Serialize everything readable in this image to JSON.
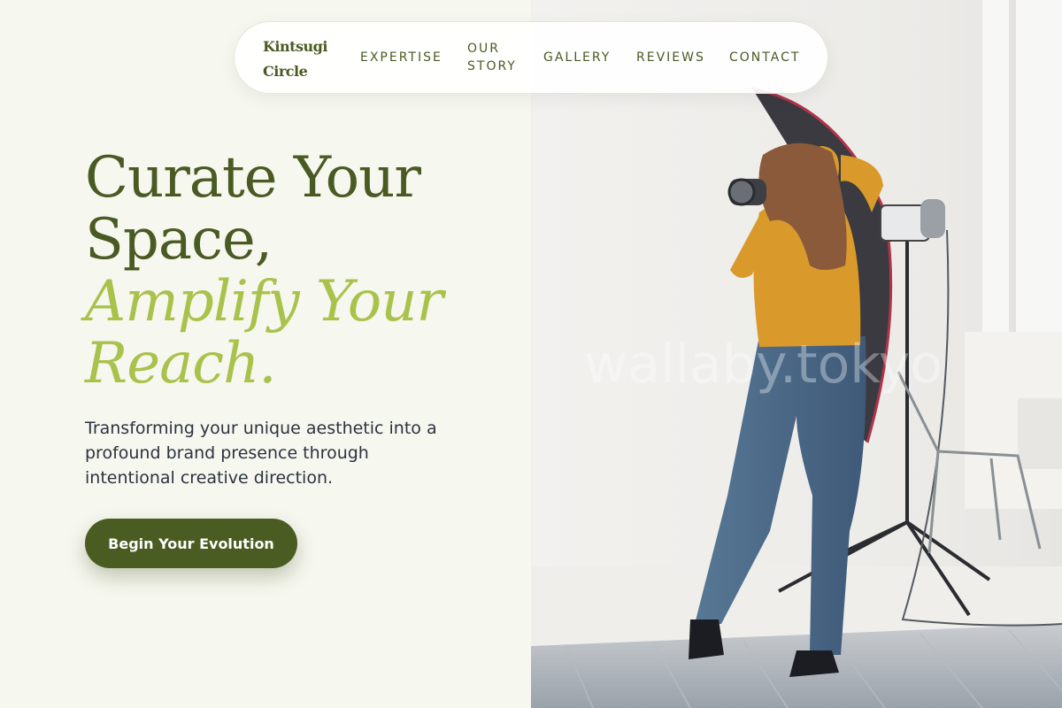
{
  "brand": {
    "line1": "Kintsugi",
    "line2": "Circle"
  },
  "nav": {
    "expertise": "EXPERTISE",
    "story_line1": "OUR",
    "story_line2": "STORY",
    "gallery": "GALLERY",
    "reviews": "REVIEWS",
    "contact": "CONTACT"
  },
  "hero": {
    "headline_line1": "Curate Your",
    "headline_line2": "Space,",
    "accent_line1": "Amplify Your",
    "accent_line2": "Reach.",
    "subtext": "Transforming your unique aesthetic into a profound brand presence through intentional creative direction.",
    "cta_label": "Begin Your Evolution"
  },
  "photo": {
    "watermark": "wallaby.tokyo",
    "description_icon": "photographer-in-studio-image"
  },
  "colors": {
    "brand_dark": "#4a5a23",
    "brand_accent": "#a9c24b",
    "background": "#f6f7ef",
    "cta_bg": "#4b5c22"
  }
}
